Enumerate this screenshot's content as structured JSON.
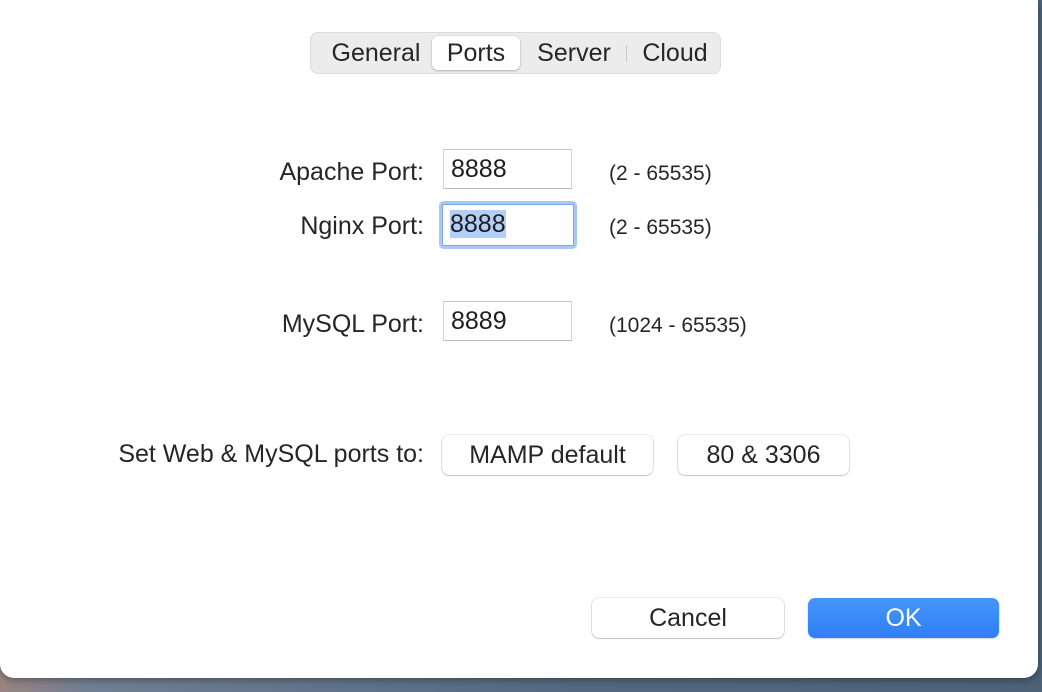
{
  "tabs": [
    {
      "label": "General",
      "selected": false
    },
    {
      "label": "Ports",
      "selected": true
    },
    {
      "label": "Server",
      "selected": false
    },
    {
      "label": "Cloud",
      "selected": false
    }
  ],
  "ports": {
    "apache": {
      "label": "Apache Port:",
      "value": "8888",
      "range": "(2 - 65535)"
    },
    "nginx": {
      "label": "Nginx Port:",
      "value": "8888",
      "range": "(2 - 65535)"
    },
    "mysql": {
      "label": "MySQL Port:",
      "value": "8889",
      "range": "(1024 - 65535)"
    }
  },
  "presets": {
    "label": "Set Web & MySQL ports to:",
    "mamp_default": "MAMP default",
    "standard": "80 & 3306"
  },
  "footer": {
    "cancel": "Cancel",
    "ok": "OK"
  },
  "colors": {
    "accent": "#2f7ff5",
    "selection": "#b3cef7",
    "focus_ring": "#a9c6f4"
  }
}
